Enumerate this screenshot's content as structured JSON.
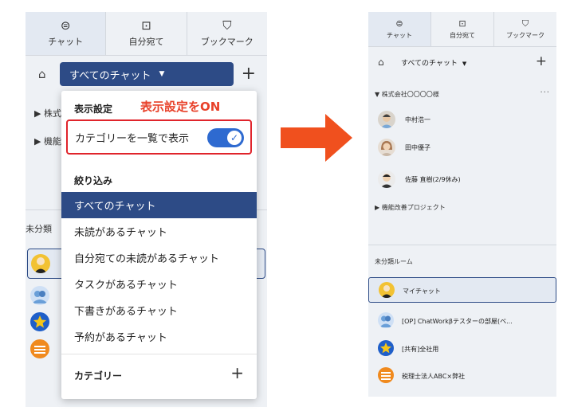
{
  "tabs": [
    {
      "label": "チャット",
      "icon": "chat-bubble-icon",
      "glyph": "⊜"
    },
    {
      "label": "自分宛て",
      "icon": "to-icon",
      "glyph": "⊡"
    },
    {
      "label": "ブックマーク",
      "icon": "bookmark-icon",
      "glyph": "⛉"
    }
  ],
  "left": {
    "filter_label": "すべてのチャット",
    "caret": "▼",
    "home_glyph": "⌂",
    "plus_glyph": "+",
    "groups": [
      "▶ 株式",
      "▶ 機能"
    ],
    "uncategorized": "未分類",
    "dropdown": {
      "display_settings_heading": "表示設定",
      "toggle_label": "カテゴリーを一覧で表示",
      "toggle_on": true,
      "check_glyph": "✓",
      "filter_heading": "絞り込み",
      "items": [
        "すべてのチャット",
        "未読があるチャット",
        "自分宛ての未読があるチャット",
        "タスクがあるチャット",
        "下書きがあるチャット",
        "予約があるチャット"
      ],
      "selected_index": 0,
      "category_heading": "カテゴリー",
      "plus_glyph": "+"
    },
    "annotation": "表示設定をON"
  },
  "right": {
    "filter_label": "すべてのチャット",
    "caret": "▼",
    "home_glyph": "⌂",
    "plus_glyph": "+",
    "group1": "▼ 株式会社〇〇〇〇様",
    "group1_menu": "···",
    "members": [
      "中村浩一",
      "田中優子",
      "佐藤 直樹(2/9休み)"
    ],
    "group2": "▶ 機能改善プロジェクト",
    "uncategorized": "未分類ルーム",
    "rooms": [
      "マイチャット",
      "[OP] ChatWorkβテスターの部屋(ベ...",
      "[共有]全社用",
      "税理士法人ABC×弊社"
    ]
  },
  "colors": {
    "accent": "#2d4b86",
    "toggle": "#2e6ad0",
    "highlight": "#e0242b",
    "annotation": "#e8412a",
    "arrow": "#f0501e",
    "panel_bg": "#eef1f5"
  }
}
